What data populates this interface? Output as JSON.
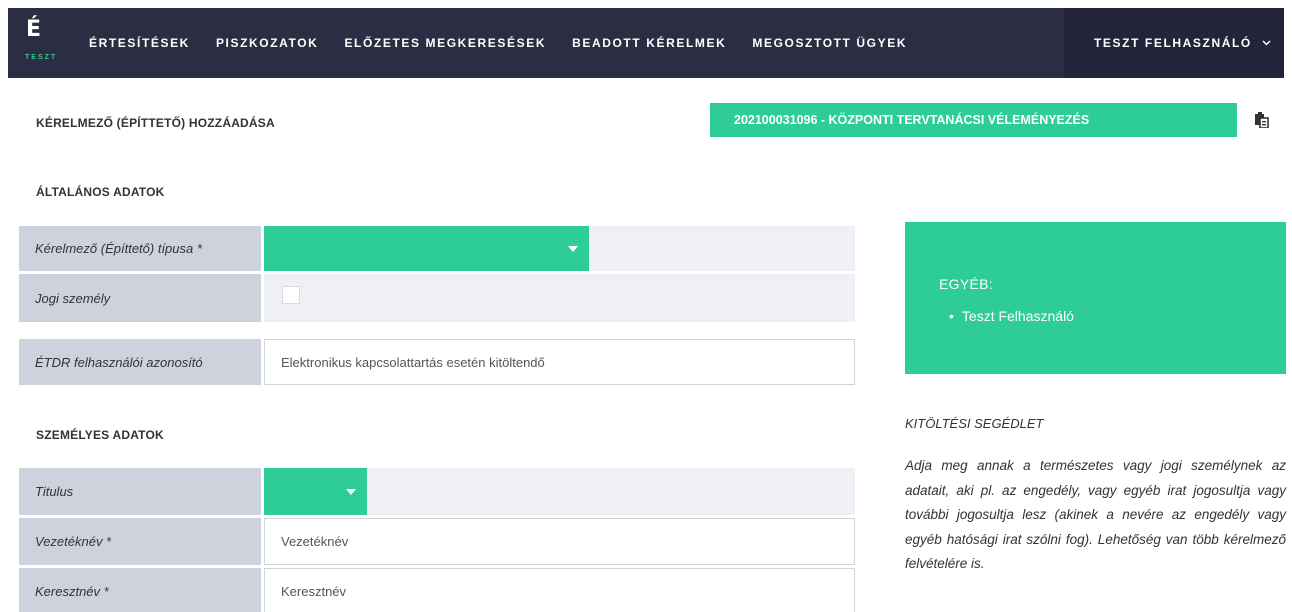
{
  "header": {
    "logo_letter": "É",
    "logo_sub": "TESZT",
    "nav": [
      {
        "label": "ÉRTESÍTÉSEK"
      },
      {
        "label": "PISZKOZATOK"
      },
      {
        "label": "ELŐZETES MEGKERESÉSEK"
      },
      {
        "label": "BEADOTT KÉRELMEK"
      },
      {
        "label": "MEGOSZTOTT ÜGYEK"
      }
    ],
    "user": "TESZT FELHASZNÁLÓ"
  },
  "page": {
    "title": "KÉRELMEZŐ (ÉPÍTTETŐ) HOZZÁADÁSA",
    "case_banner": "202100031096 - KÖZPONTI TERVTANÁCSI VÉLEMÉNYEZÉS"
  },
  "general": {
    "title": "ÁLTALÁNOS ADATOK",
    "type_label": "Kérelmező (Építtető) típusa *",
    "legal_label": "Jogi személy",
    "etdr_label": "ÉTDR felhasználói azonosító",
    "etdr_placeholder": "Elektronikus kapcsolattartás esetén kitöltendő"
  },
  "personal": {
    "title": "SZEMÉLYES ADATOK",
    "title_label": "Titulus",
    "lastname_label": "Vezetéknév *",
    "lastname_placeholder": "Vezetéknév",
    "firstname_label": "Keresztnév *",
    "firstname_placeholder": "Keresztnév"
  },
  "info_box": {
    "title": "EGYÉB:",
    "items": [
      "Teszt Felhasználó"
    ]
  },
  "help": {
    "title": "KITÖLTÉSI SEGÉDLET",
    "text": "Adja meg annak a természetes vagy jogi személynek az adatait, aki pl. az engedély, vagy egyéb irat jogosultja vagy további jogosultja lesz (akinek a nevére az engedély vagy egyéb hatósági irat szólni fog). Lehetőség van több kérelmező felvételére is."
  },
  "colors": {
    "nav_bg": "#2b2d42",
    "accent": "#2ecc96",
    "label_bg": "#ced2dc"
  }
}
